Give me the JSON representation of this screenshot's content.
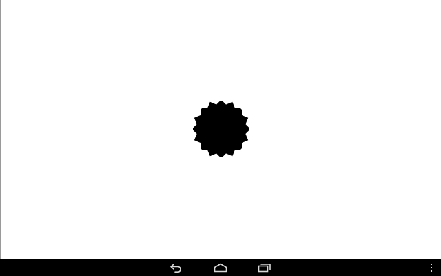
{
  "screen": {
    "background": "#ffffff"
  },
  "canvas": {
    "shape": {
      "kind": "eight-petal-badge",
      "color": "#000000"
    }
  },
  "navbar": {
    "background": "#000000",
    "icon_color": "#d8d8d8",
    "buttons": [
      {
        "name": "back",
        "icon": "back-arrow-icon"
      },
      {
        "name": "home",
        "icon": "home-icon"
      },
      {
        "name": "recents",
        "icon": "recent-apps-icon"
      },
      {
        "name": "menu",
        "icon": "overflow-menu-icon"
      }
    ]
  }
}
